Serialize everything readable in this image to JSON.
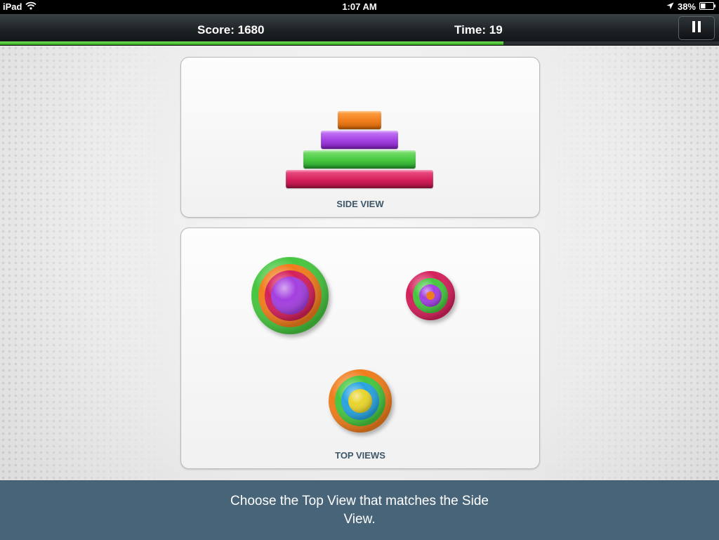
{
  "status_bar": {
    "device": "iPad",
    "time": "1:07 AM",
    "battery": "38%",
    "battery_level": 0.38
  },
  "header": {
    "score": "Score: 1680",
    "time": "Time: 19",
    "timer_progress": 0.7
  },
  "side_view": {
    "label": "SIDE VIEW",
    "disks_top_to_bottom": [
      "orange",
      "purple",
      "green",
      "crimson"
    ]
  },
  "top_views": {
    "label": "TOP VIEWS",
    "options": [
      {
        "name": "option-a",
        "rings_outer_to_inner": [
          "green",
          "orange",
          "crimson",
          "purple"
        ]
      },
      {
        "name": "option-b",
        "rings_outer_to_inner": [
          "crimson",
          "green",
          "purple",
          "orange"
        ]
      },
      {
        "name": "option-c",
        "rings_outer_to_inner": [
          "orange",
          "green",
          "blue",
          "yellow"
        ]
      }
    ]
  },
  "colors": {
    "orange": "#f07d1c",
    "purple": "#a33fe0",
    "green": "#46c63f",
    "crimson": "#d4205a",
    "blue": "#27a3e0",
    "yellow": "#e8d42c",
    "progress": "#3fbf2a",
    "instruction_bg": "#486479"
  },
  "instruction": "Choose the Top View that matches the Side View."
}
